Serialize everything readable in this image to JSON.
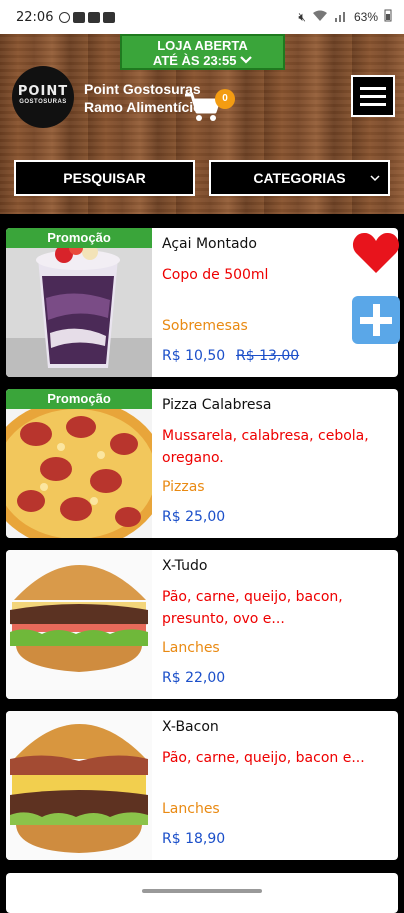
{
  "status_bar": {
    "time": "22:06",
    "battery": "63%"
  },
  "header": {
    "store_status_line1": "LOJA ABERTA",
    "store_status_line2": "ATÉ ÀS 23:55",
    "logo_line1": "POINT",
    "logo_line2": "GOSTOSURAS",
    "store_name": "Point Gostosuras",
    "store_category": "Ramo Alimentício",
    "cart_count": "0",
    "search_label": "PESQUISAR",
    "categories_label": "CATEGORIAS"
  },
  "products": [
    {
      "name": "Açai Montado",
      "description": "Copo de 500ml",
      "category": "Sobremesas",
      "price": "R$ 10,50",
      "old_price": "R$ 13,00",
      "promo": "Promoção"
    },
    {
      "name": "Pizza Calabresa",
      "description": "Mussarela, calabresa, cebola, oregano.",
      "category": "Pizzas",
      "price": "R$ 25,00",
      "promo": "Promoção"
    },
    {
      "name": "X-Tudo",
      "description": "Pão, carne, queijo, bacon, presunto, ovo e...",
      "category": "Lanches",
      "price": "R$ 22,00"
    },
    {
      "name": "X-Bacon",
      "description": "Pão, carne, queijo, bacon e...",
      "category": "Lanches",
      "price": "R$ 18,90"
    }
  ],
  "colors": {
    "promo_green": "#3aa53a",
    "desc_red": "#e00000",
    "category_orange": "#e98a13",
    "price_blue": "#1b4fc9",
    "plus_blue": "#5aa7e8",
    "heart_red": "#e8141c"
  }
}
